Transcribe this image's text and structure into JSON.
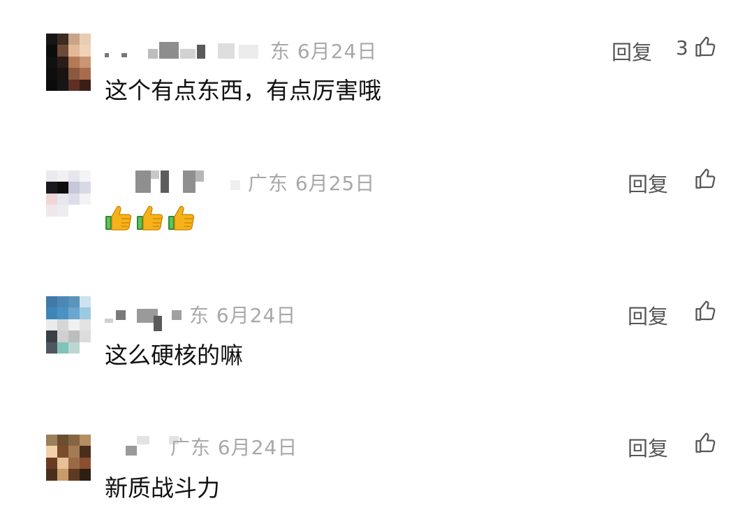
{
  "comments": [
    {
      "location_date": "东 6月24日",
      "reply_label": "回复",
      "like_count": "3",
      "text": "这个有点东西，有点厉害哦",
      "emoji_count": 0
    },
    {
      "location_date": "广东 6月25日",
      "reply_label": "回复",
      "like_count": "",
      "text": "",
      "emoji_count": 3
    },
    {
      "location_date": "东 6月24日",
      "reply_label": "回复",
      "like_count": "",
      "text": "这么硬核的嘛",
      "emoji_count": 0
    },
    {
      "location_date": "广东 6月24日",
      "reply_label": "回复",
      "like_count": "",
      "text": "新质战斗力",
      "emoji_count": 0
    }
  ],
  "icons": {
    "like": "thumbs-up-outline-icon",
    "emoji": "thumbs-up-emoji-icon"
  },
  "colors": {
    "meta": "#a8a8a8",
    "action": "#555555",
    "text": "#111111"
  }
}
